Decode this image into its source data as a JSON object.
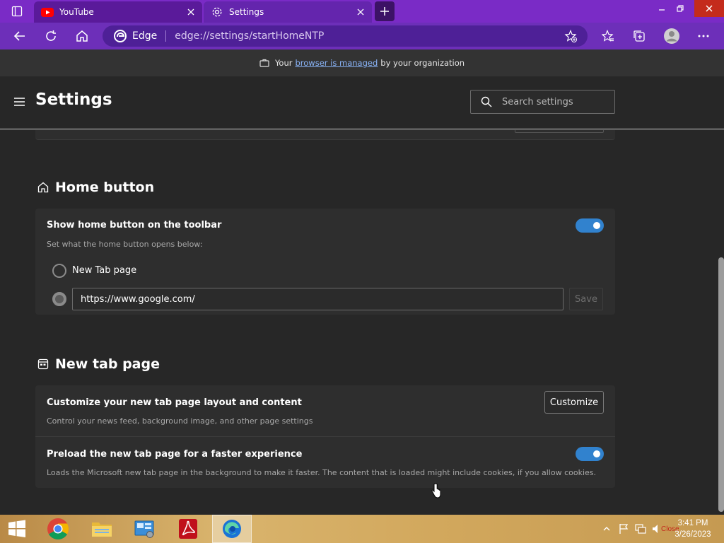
{
  "browser": {
    "tabs": [
      {
        "title": "YouTube",
        "icon": "youtube-icon"
      },
      {
        "title": "Settings",
        "icon": "gear-icon"
      }
    ],
    "omnibox": {
      "site_label": "Edge",
      "url": "edge://settings/startHomeNTP"
    },
    "managed_banner": {
      "prefix": "Your",
      "link": "browser is managed",
      "suffix": "by your organization"
    }
  },
  "settings": {
    "title": "Settings",
    "search_placeholder": "Search settings",
    "home_button": {
      "title": "Home button",
      "show_label": "Show home button on the toolbar",
      "show_enabled": true,
      "desc": "Set what the home button opens below:",
      "option_new_tab": "New Tab page",
      "url_value": "https://www.google.com/",
      "selected_option": "url",
      "save_label": "Save"
    },
    "new_tab_page": {
      "title": "New tab page",
      "customize_label": "Customize your new tab page layout and content",
      "customize_desc": "Control your news feed, background image, and other page settings",
      "customize_button": "Customize",
      "preload_label": "Preload the new tab page for a faster experience",
      "preload_desc": "Loads the Microsoft new tab page in the background to make it faster. The content that is loaded might include cookies, if you allow cookies.",
      "preload_enabled": true
    }
  },
  "taskbar": {
    "apps": [
      "start-button",
      "chrome-icon",
      "file-explorer-icon",
      "control-panel-icon",
      "acrobat-icon",
      "edge-icon"
    ],
    "tray_close_label": "Close",
    "time": "3:41 PM",
    "date": "3/26/2023"
  },
  "colors": {
    "tab_strip": "#7a2bc6",
    "toolbar": "#6d2fb9",
    "toggle_on": "#3182ce",
    "page_bg": "#272727",
    "card_bg": "#2e2e2e"
  }
}
